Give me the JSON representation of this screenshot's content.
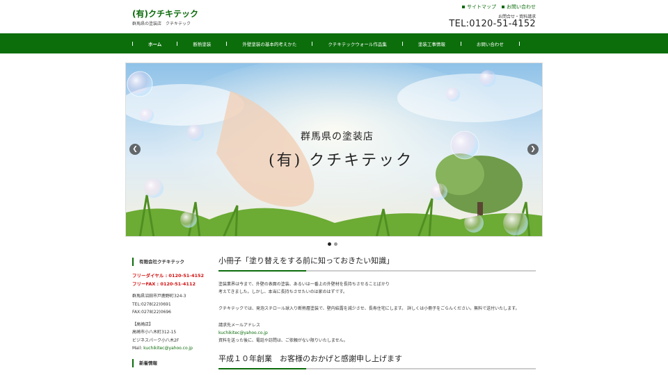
{
  "header": {
    "logo": "(有)クチキテック",
    "tagline": "群馬県の塗装店　クチキテック",
    "top_links": [
      "サイトマップ",
      "お問い合わせ"
    ],
    "contact_label": "お問合せ・資料請求",
    "tel": "TEL:0120-51-4152"
  },
  "nav": {
    "items": [
      "ホーム",
      "断熱塗装",
      "外壁塗装の基本的考えかた",
      "クチキテックウォール作品集",
      "塗装工事情報",
      "お問い合わせ"
    ]
  },
  "slider": {
    "line1": "群馬県の塗装店",
    "line2": "(有) クチキテック",
    "prev": "❮",
    "next": "❯",
    "slides": 2,
    "active_slide": 1
  },
  "sidebar": {
    "heading": "有限会社クチキテック",
    "free_dial": "フリーダイヤル : 0120-51-4152",
    "free_fax": "フリーFAX : 0120-51-4112",
    "address": "群馬県沼田市戸鹿野町324-3",
    "tel": "TEL:0278(22)0691",
    "fax": "FAX:0278(22)0696",
    "branch_label": "【高崎店】",
    "branch_addr1": "高崎市小八木町312-15",
    "branch_addr2": "ビジネスパーク小八木2F",
    "mail_prefix": "Mail: ",
    "mail": "kuchikitec@yahoo.co.jp",
    "news_heading": "新着情報"
  },
  "main": {
    "section1_title": "小冊子「塗り替えをする前に知っておきたい知識」",
    "para1_line1": "塗装業界は今まで、外壁の表面の塗装、あるいは一番上の外壁材を長持ちさせることばかり",
    "para1_line2": "考えてきました。しかし、本当に長持ちさせたいのは家のはずです。",
    "para2": "クチキテックでは、発泡スチロール球入り断熱層塗装で、壁内結露を減少させ、長寿住宅にします。 詳しくは小冊子をごらんください。無料で送付いたします。",
    "request_label": "請求先メールアドレス",
    "request_mail": "kuchikitec@yahoo.co.jp",
    "request_note": "資料を送った後に、電話や訪問は、ご依頼がない限りいたしません。",
    "section2_title": "平成１０年創業　お客様のおかげと感謝申し上げます"
  },
  "colors": {
    "brand_green": "#0b6e0b",
    "red": "#d21010"
  }
}
